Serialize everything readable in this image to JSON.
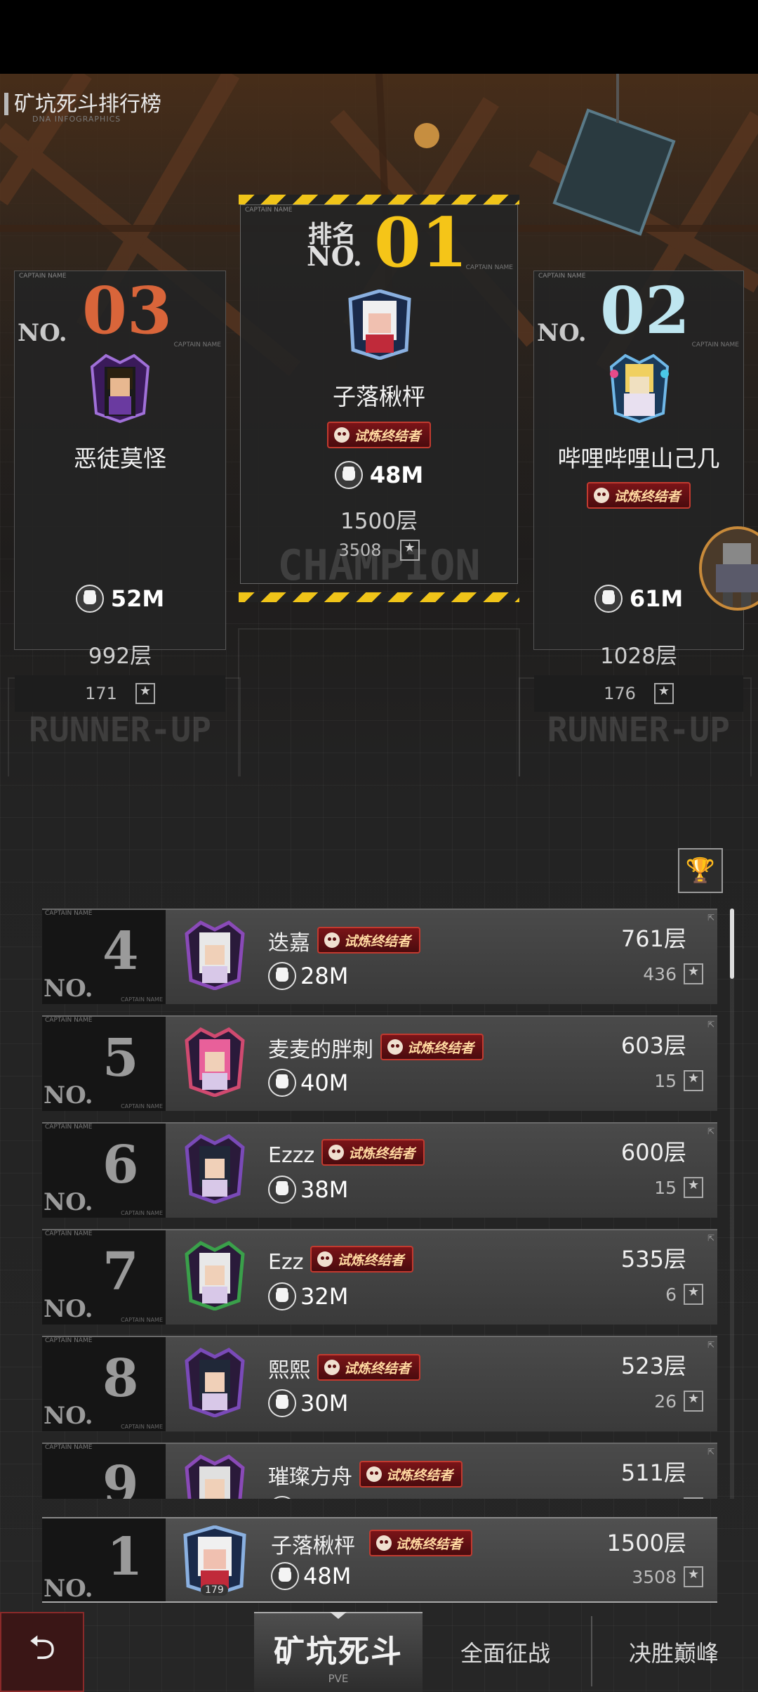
{
  "page": {
    "title": "矿坑死斗排行榜",
    "subtitle": "DNA INFOGRAPHICS"
  },
  "podium": {
    "first": {
      "rank_label": "排名",
      "no": "NO.",
      "rank": "01",
      "name": "子落楸枰",
      "badge": "试炼终结者",
      "power": "48M",
      "floor": "1500层",
      "stat": "3508",
      "ghost": "CHAMPION"
    },
    "second": {
      "no": "NO.",
      "rank": "02",
      "name": "哔哩哔哩山己几",
      "badge": "试炼终结者",
      "power": "61M",
      "floor": "1028层",
      "stat": "176",
      "ghost": "RUNNER-UP"
    },
    "third": {
      "no": "NO.",
      "rank": "03",
      "name": "恶徒莫怪",
      "power": "52M",
      "floor": "992层",
      "stat": "171",
      "ghost": "RUNNER-UP"
    },
    "card_tag": "CAPTAIN NAME"
  },
  "list": [
    {
      "rank": "4",
      "name": "迭嘉",
      "badge": "试炼终结者",
      "power": "28M",
      "floor": "761层",
      "stat": "436",
      "hair": "#e8e8e8",
      "crest": "#8a4ab8"
    },
    {
      "rank": "5",
      "name": "麦麦的胖刺",
      "badge": "试炼终结者",
      "power": "40M",
      "floor": "603层",
      "stat": "15",
      "hair": "#e8609a",
      "crest": "#d04a70"
    },
    {
      "rank": "6",
      "name": "Ezzz",
      "badge": "试炼终结者",
      "power": "38M",
      "floor": "600层",
      "stat": "15",
      "hair": "#202838",
      "crest": "#7a4ab8"
    },
    {
      "rank": "7",
      "name": "Ezz",
      "badge": "试炼终结者",
      "power": "32M",
      "floor": "535层",
      "stat": "6",
      "hair": "#e8e8e8",
      "crest": "#3aa04a"
    },
    {
      "rank": "8",
      "name": "熙熙",
      "badge": "试炼终结者",
      "power": "30M",
      "floor": "523层",
      "stat": "26",
      "hair": "#202838",
      "crest": "#7a4ab8"
    },
    {
      "rank": "9",
      "name": "璀璨方舟",
      "badge": "试炼终结者",
      "power": "",
      "floor": "511层",
      "stat": "",
      "hair": "#e0e0e0",
      "crest": "#8a4ab8"
    }
  ],
  "mine": {
    "no": "NO.",
    "rank": "1",
    "name": "子落楸枰",
    "badge": "试炼终结者",
    "power": "48M",
    "floor": "1500层",
    "stat": "3508",
    "level": "179"
  },
  "tabs": {
    "active": "矿坑死斗",
    "active_sub": "PVE",
    "tab2": "全面征战",
    "tab3": "决胜巅峰"
  },
  "icons": {
    "back": "back-arrow-icon",
    "trophy": "trophy-icon",
    "power": "fist-icon",
    "stat": "flag-star-icon"
  },
  "colors": {
    "gold": "#f5c518",
    "bronze": "#d9653a",
    "silver": "#bfe6f0",
    "badge_red": "#7a1418"
  }
}
